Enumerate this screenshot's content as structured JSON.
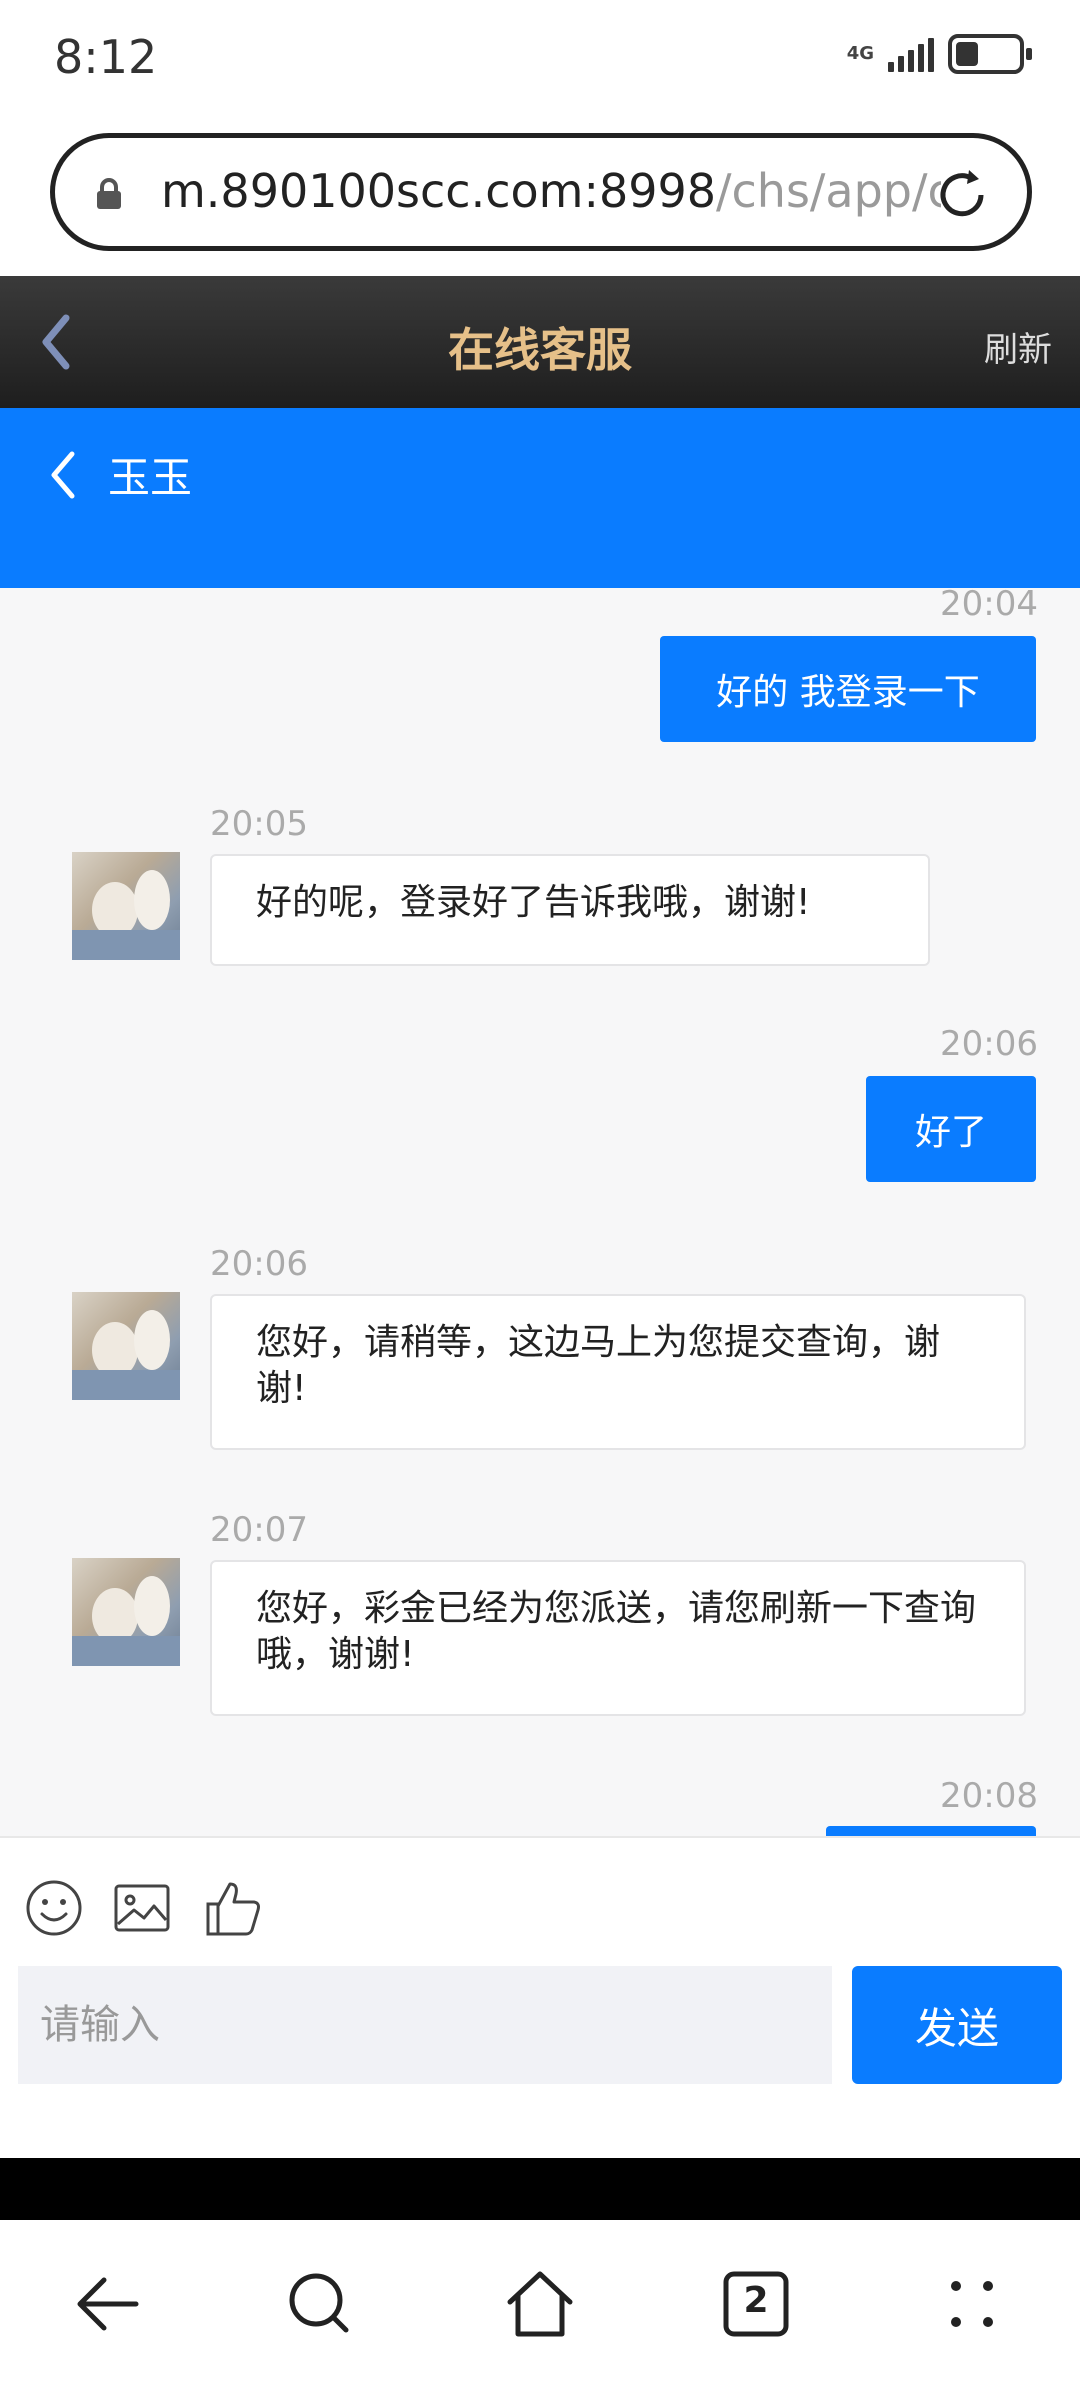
{
  "status": {
    "time": "8:12",
    "network": "4G"
  },
  "browser": {
    "url_host": "m.890100scc.com:8998",
    "url_path": "/chs/app/c",
    "tab_count": "2"
  },
  "app_header": {
    "title": "在线客服",
    "refresh_label": "刷新"
  },
  "chat": {
    "agent_name": "玉玉",
    "messages": [
      {
        "direction": "out",
        "time": "20:04",
        "text": "好的 我登录一下"
      },
      {
        "direction": "in",
        "time": "20:05",
        "text": "好的呢，登录好了告诉我哦，谢谢!"
      },
      {
        "direction": "out",
        "time": "20:06",
        "text": "好了"
      },
      {
        "direction": "in",
        "time": "20:06",
        "text": "您好，请稍等，这边马上为您提交查询，谢谢!"
      },
      {
        "direction": "in",
        "time": "20:07",
        "text": "您好，彩金已经为您派送，请您刷新一下查询哦，谢谢!"
      },
      {
        "direction": "out",
        "time": "20:08",
        "text": ""
      }
    ]
  },
  "composer": {
    "placeholder": "请输入",
    "send_label": "发送"
  },
  "colors": {
    "accent": "#0a7cff",
    "header_dark": "#2a2a2a",
    "title_gold": "#e6c089"
  }
}
